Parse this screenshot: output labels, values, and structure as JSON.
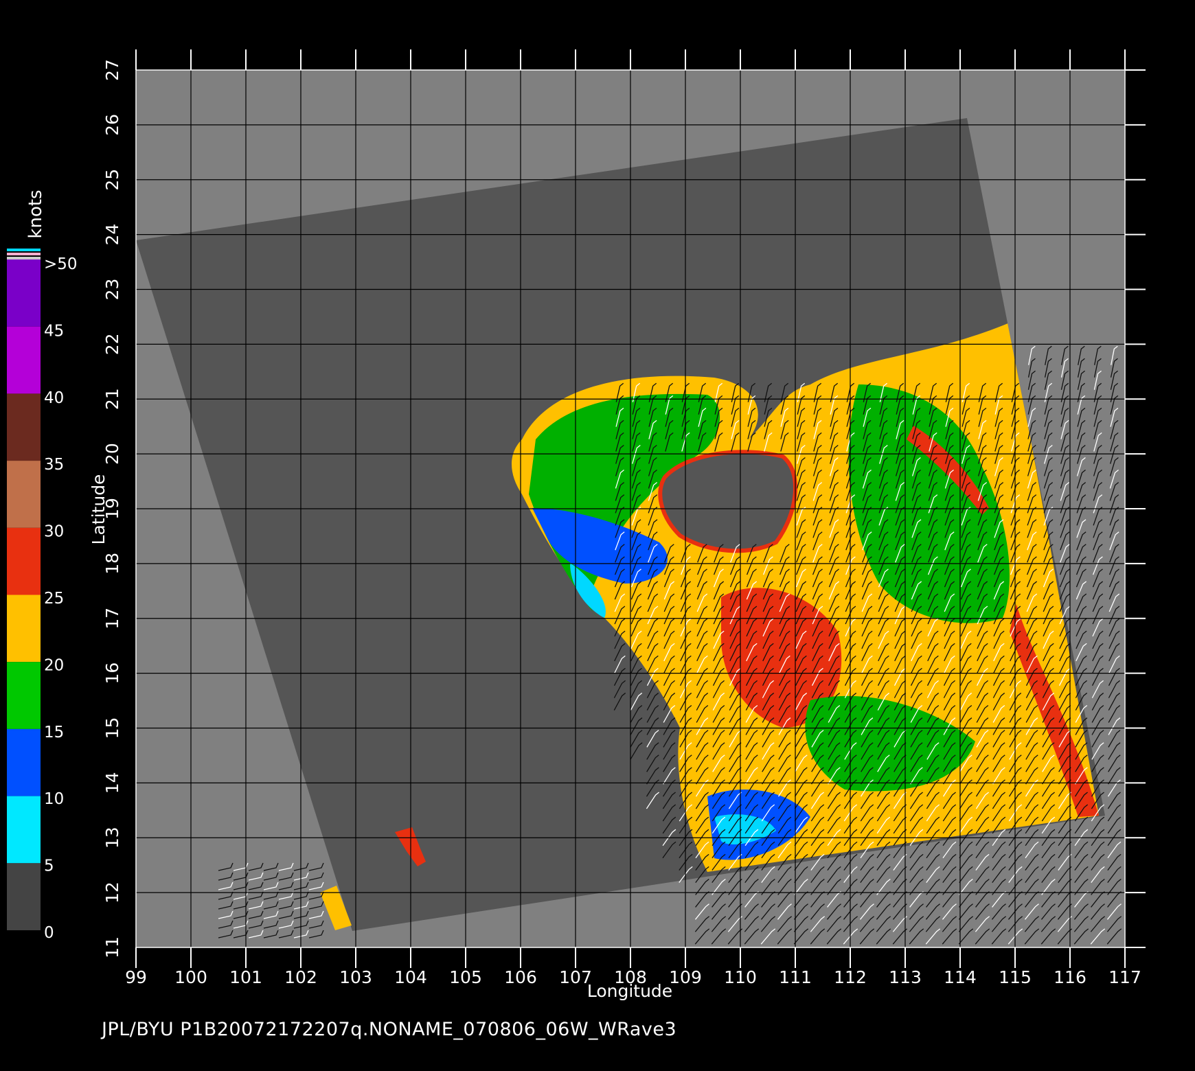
{
  "map": {
    "x_axis_label": "Longitude",
    "y_axis_label": "Latitude",
    "lon_range": [
      99,
      117
    ],
    "lat_range": [
      11,
      27
    ],
    "lon_ticks": [
      "99",
      "100",
      "101",
      "102",
      "103",
      "104",
      "105",
      "106",
      "107",
      "108",
      "109",
      "110",
      "111",
      "112",
      "113",
      "114",
      "115",
      "116",
      "117"
    ],
    "lat_ticks": [
      "11",
      "12",
      "13",
      "14",
      "15",
      "16",
      "17",
      "18",
      "19",
      "20",
      "21",
      "22",
      "23",
      "24",
      "25",
      "26",
      "27"
    ],
    "colors": {
      "background": "#000000",
      "out_of_swath": "#808080",
      "land_in_swath": "#555555",
      "grid": "#000000",
      "tick": "#ffffff"
    }
  },
  "legend": {
    "unit": "knots",
    "labels": [
      ">50",
      "45",
      "40",
      "35",
      "30",
      "25",
      "20",
      "15",
      "10",
      "5",
      "0"
    ],
    "bands": [
      {
        "from": 45,
        "to": 50,
        "color": "#7a00c8"
      },
      {
        "from": 40,
        "to": 45,
        "color": "#b400d8"
      },
      {
        "from": 35,
        "to": 40,
        "color": "#6b2a1f"
      },
      {
        "from": 30,
        "to": 35,
        "color": "#c0704a"
      },
      {
        "from": 25,
        "to": 30,
        "color": "#e83010"
      },
      {
        "from": 20,
        "to": 25,
        "color": "#ffc000"
      },
      {
        "from": 15,
        "to": 20,
        "color": "#00c800"
      },
      {
        "from": 10,
        "to": 15,
        "color": "#0050ff"
      },
      {
        "from": 5,
        "to": 10,
        "color": "#00e8ff"
      },
      {
        "from": 0,
        "to": 5,
        "color": "#444444"
      }
    ]
  },
  "footer": {
    "text": "JPL/BYU  P1B20072172207q.NONAME_070806_06W_WRave3"
  }
}
